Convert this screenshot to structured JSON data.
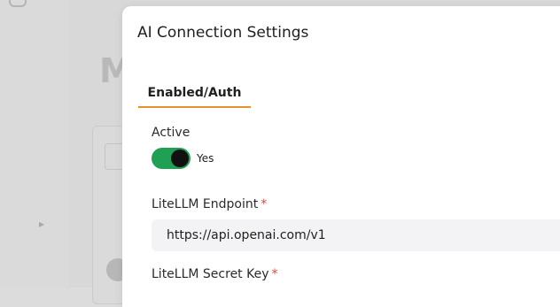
{
  "modal": {
    "title": "AI Connection Settings",
    "tabs": [
      {
        "label": "Enabled/Auth",
        "active": true
      }
    ],
    "active_label": "Active",
    "toggle": {
      "on": true,
      "text": "Yes"
    },
    "endpoint": {
      "label": "LiteLLM Endpoint",
      "required": "*",
      "value": "https://api.openai.com/v1"
    },
    "secret": {
      "label": "LiteLLM Secret Key",
      "required": "*"
    }
  },
  "colors": {
    "accent": "#e8902c",
    "toggle_on": "#1fa055",
    "required": "#e0443a"
  }
}
